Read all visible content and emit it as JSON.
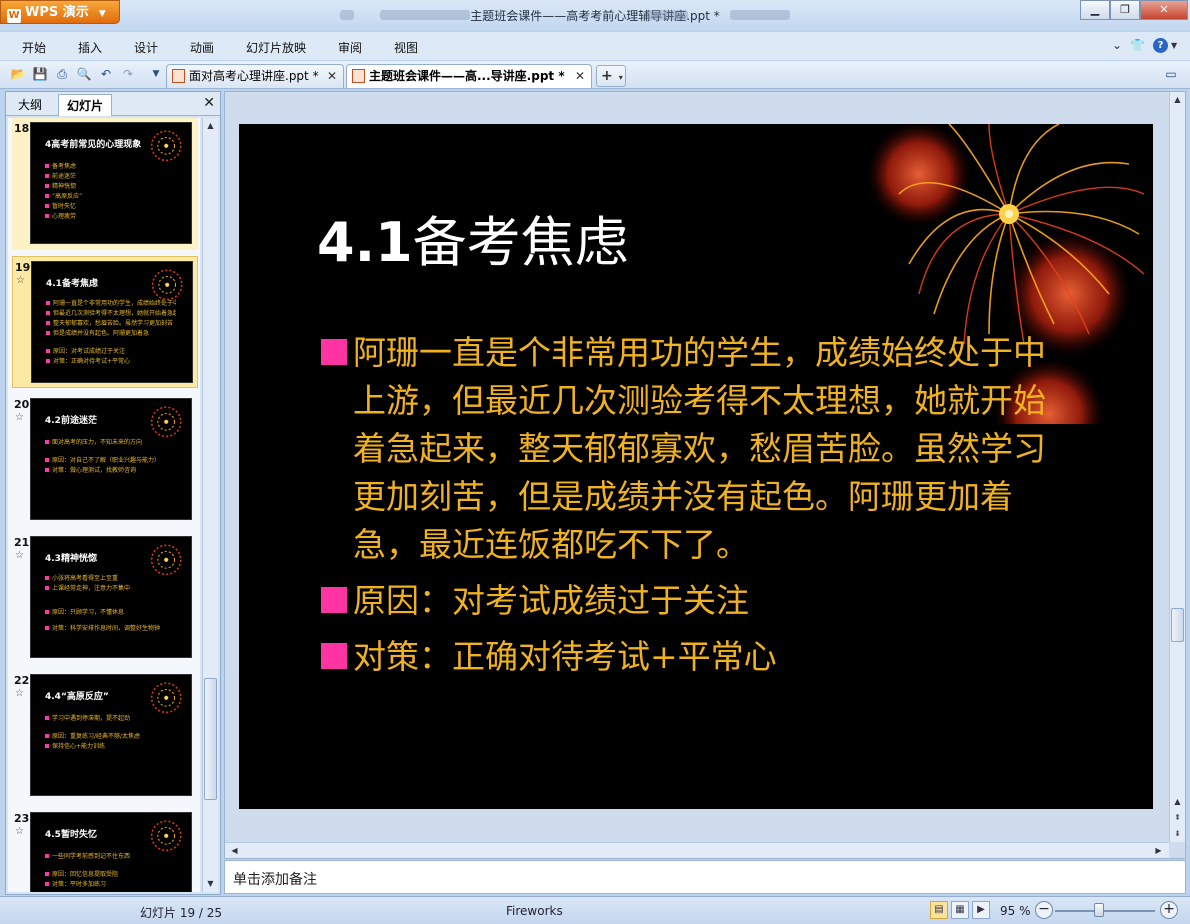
{
  "app": {
    "brand": "WPS 演示",
    "window_title": "主题班会课件——高考考前心理辅导讲座.ppt *"
  },
  "menu": {
    "items": [
      "开始",
      "插入",
      "设计",
      "动画",
      "幻灯片放映",
      "审阅",
      "视图"
    ]
  },
  "tabs": [
    {
      "label": "面对高考心理讲座.ppt *",
      "active": false
    },
    {
      "label": "主题班会课件——高...导讲座.ppt *",
      "active": true
    }
  ],
  "panel": {
    "tabs": [
      "大纲",
      "幻灯片"
    ],
    "active_tab": "幻灯片"
  },
  "thumbnails": [
    {
      "number": "18",
      "title": "4高考前常见的心理现象",
      "lines": [
        "备考焦虑",
        "前途迷茫",
        "精神恍惚",
        "“高原反应”",
        "暂时失忆",
        "心理疲劳"
      ]
    },
    {
      "number": "19",
      "title": "4.1备考焦虑",
      "lines": [
        "阿珊一直是个非常用功的学生，成绩始终处于中上游",
        "但最近几次测验考得不太理想，她就开始着急起来",
        "整天郁郁寡欢，愁眉苦脸。虽然学习更加刻苦",
        "但是成绩并没有起色。阿珊更加着急",
        "原因：对考试成绩过于关注",
        "对策：正确对待考试+平常心"
      ]
    },
    {
      "number": "20",
      "title": "4.2前途迷茫",
      "lines": [
        "面对高考的压力，不知未来的方向",
        "原因：对自己不了解（职业兴趣与能力）",
        "对策：做心理测试，找教师咨询"
      ]
    },
    {
      "number": "21",
      "title": "4.3精神恍惚",
      "lines": [
        "小张将高考看得至上至重",
        "上课经常走神，注意力不集中",
        "原因：只顾学习，不懂休息",
        "对策：科学安排作息时间，调整好生物钟"
      ]
    },
    {
      "number": "22",
      "title": "4.4“高原反应”",
      "lines": [
        "学习中遇到停滞期，提不起劲",
        "原因：重复练习/经典不够/太焦虑",
        "保持信心+能力训练"
      ]
    },
    {
      "number": "23",
      "title": "4.5暂时失忆",
      "lines": [
        "一些同学考前感到记不住东西",
        "原因：回忆信息提取受阻",
        "对策：平时多加练习"
      ]
    }
  ],
  "slide": {
    "title_number": "4.1",
    "title_text": "备考焦虑",
    "bullets": [
      "阿珊一直是个非常用功的学生，成绩始终处于中上游，但最近几次测验考得不太理想，她就开始着急起来，整天郁郁寡欢，愁眉苦脸。虽然学习更加刻苦，但是成绩并没有起色。阿珊更加着急，最近连饭都吃不下了。",
      "原因：对考试成绩过于关注",
      "对策：正确对待考试+平常心"
    ],
    "colors": {
      "background": "#000000",
      "title": "#ffffff",
      "body": "#f0b21f",
      "bullet": "#ff34a3"
    }
  },
  "notes": {
    "placeholder": "单击添加备注"
  },
  "status": {
    "slide_counter": "幻灯片 19 / 25",
    "theme": "Fireworks",
    "zoom": "95 %"
  }
}
